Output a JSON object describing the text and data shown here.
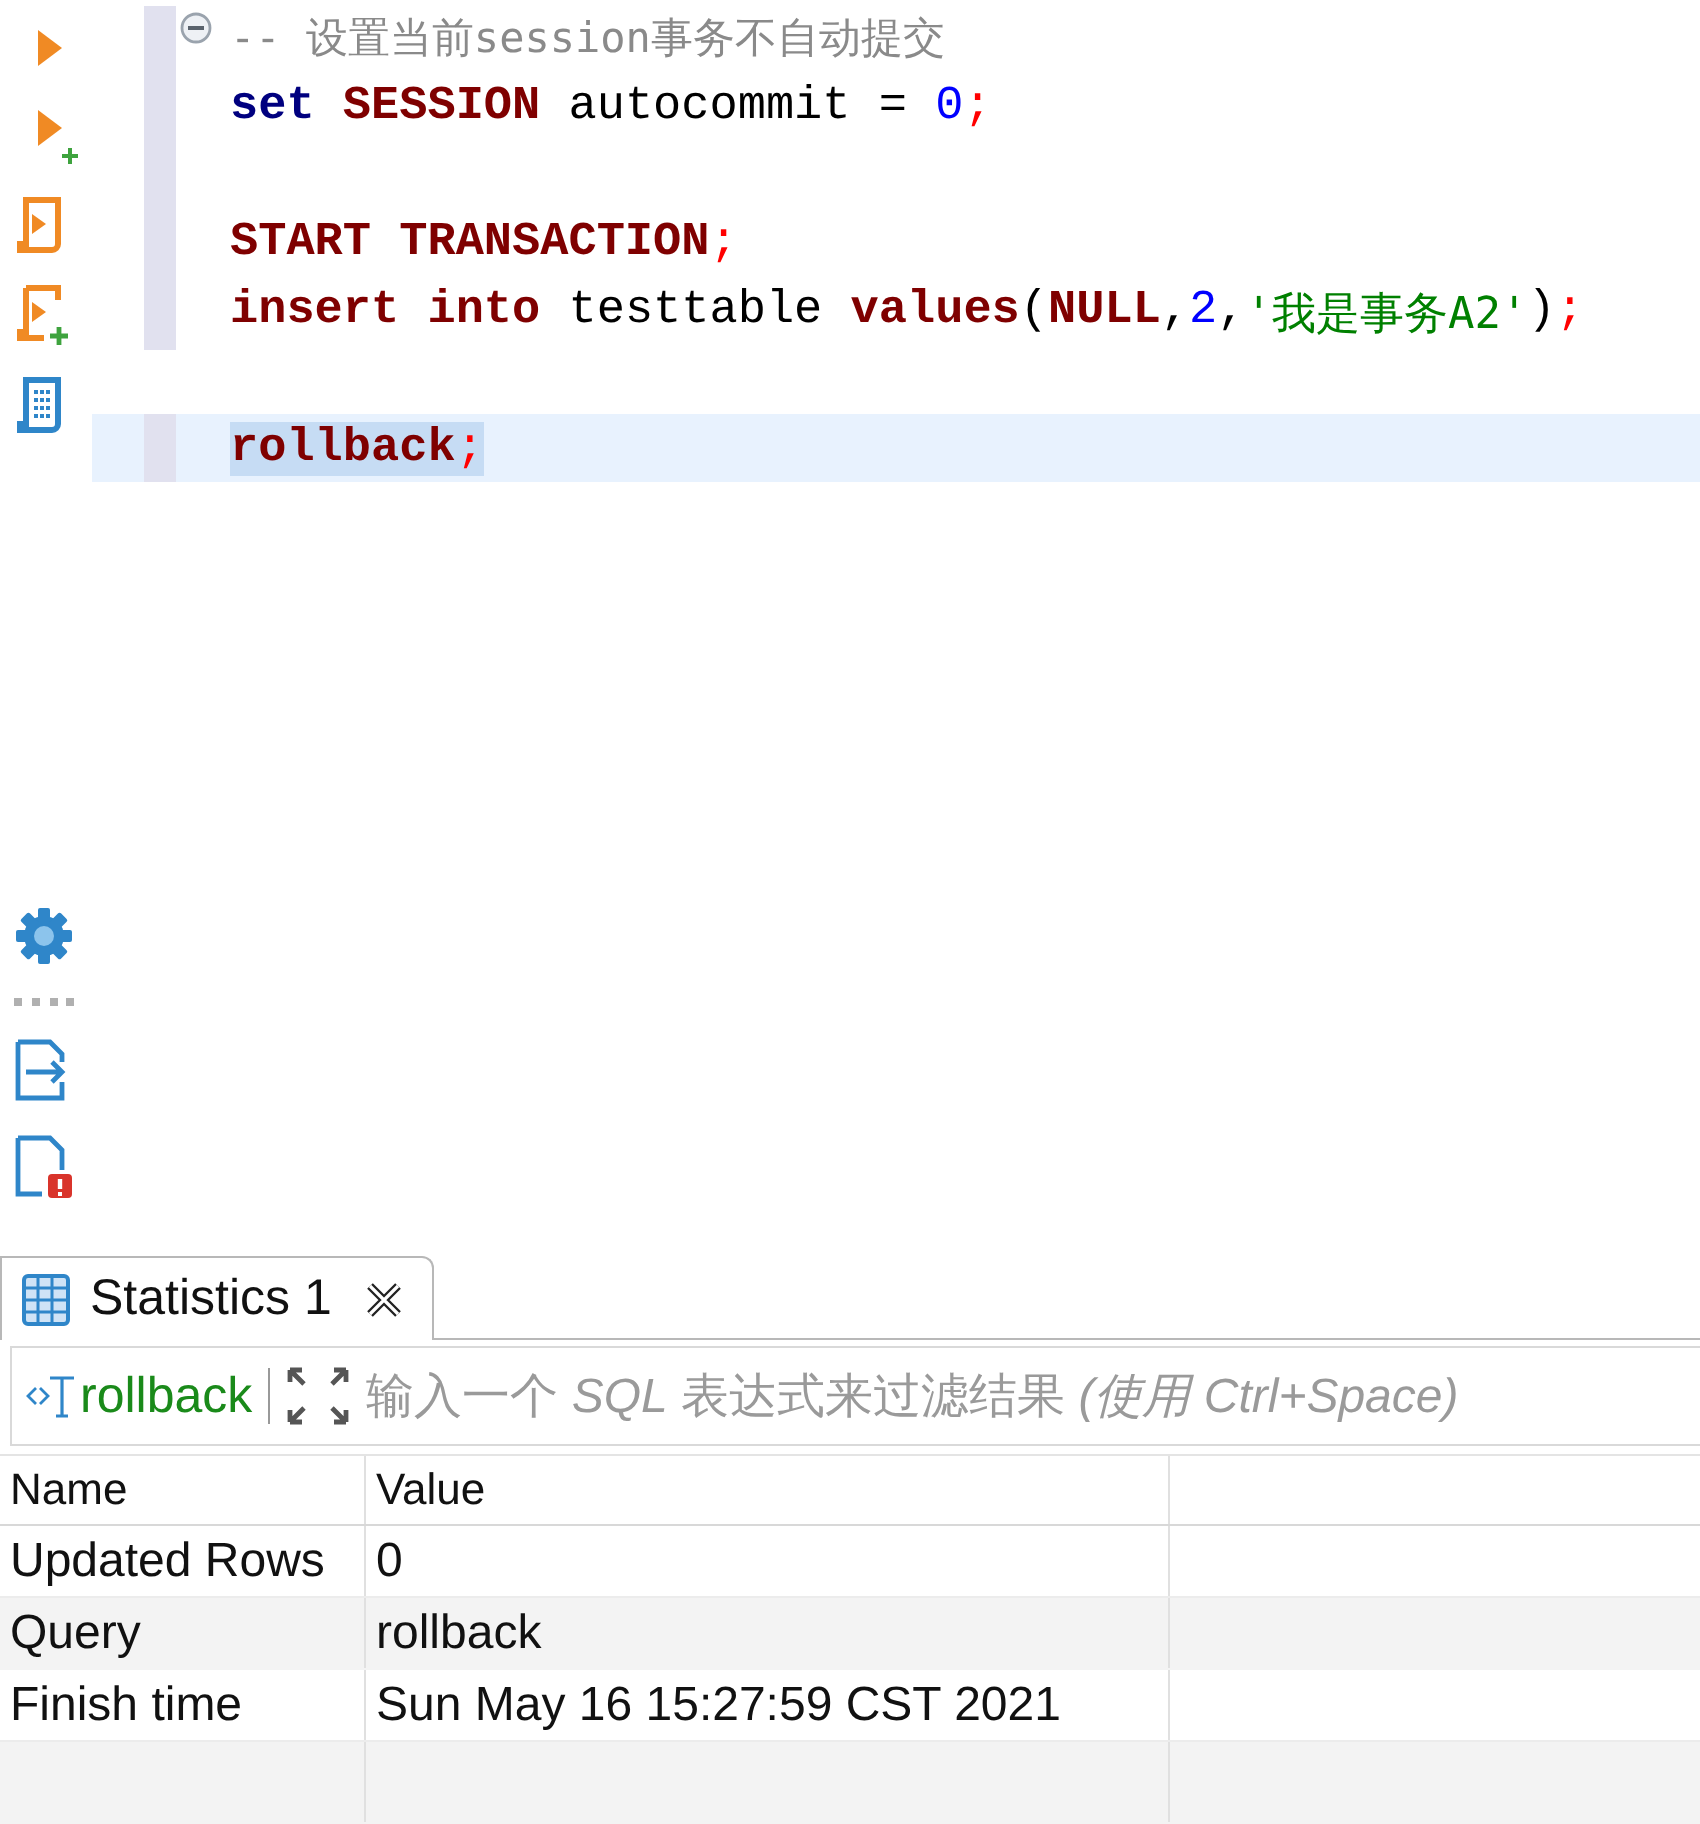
{
  "editor": {
    "lines": [
      {
        "marked": true,
        "fold": true,
        "current": false,
        "tokens": [
          {
            "kind": "comment",
            "text": "-- 设置当前session事务不自动提交"
          }
        ]
      },
      {
        "marked": true,
        "fold": false,
        "current": false,
        "tokens": [
          {
            "kind": "keyword2",
            "text": "set "
          },
          {
            "kind": "keyword",
            "text": "SESSION"
          },
          {
            "kind": "plain",
            "text": " autocommit = "
          },
          {
            "kind": "number",
            "text": "0"
          },
          {
            "kind": "punct",
            "text": ";"
          }
        ]
      },
      {
        "marked": true,
        "fold": false,
        "current": false
      },
      {
        "marked": true,
        "fold": false,
        "current": false,
        "tokens": [
          {
            "kind": "keyword",
            "text": "START TRANSACTION"
          },
          {
            "kind": "punct",
            "text": ";"
          }
        ]
      },
      {
        "marked": true,
        "fold": false,
        "current": false,
        "tokens": [
          {
            "kind": "keyword",
            "text": "insert into"
          },
          {
            "kind": "plain",
            "text": " testtable "
          },
          {
            "kind": "keyword",
            "text": "values"
          },
          {
            "kind": "plain",
            "text": "("
          },
          {
            "kind": "keyword",
            "text": "NULL"
          },
          {
            "kind": "plain",
            "text": ","
          },
          {
            "kind": "number",
            "text": "2"
          },
          {
            "kind": "plain",
            "text": ","
          },
          {
            "kind": "string",
            "text": "'我是事务A2'"
          },
          {
            "kind": "plain",
            "text": ")"
          },
          {
            "kind": "punct",
            "text": ";"
          }
        ]
      },
      {
        "marked": false,
        "fold": false,
        "current": false
      },
      {
        "marked": true,
        "fold": false,
        "current": true,
        "tokens": [
          {
            "kind": "keyword",
            "text": "rollback"
          },
          {
            "kind": "punct",
            "text": ";"
          }
        ]
      }
    ]
  },
  "results": {
    "tab": {
      "label": "Statistics 1",
      "selected": true
    },
    "filter": {
      "query": "rollback",
      "placeholder": "输入一个 *SQL* 表达式来过滤结果 *(使用 Ctrl+Space)*"
    },
    "table": {
      "columns": [
        "Name",
        "Value"
      ],
      "rows": [
        {
          "name": "Updated Rows",
          "value": "0"
        },
        {
          "name": "Query",
          "value": "rollback"
        },
        {
          "name": "Finish time",
          "value": "Sun May 16 15:27:59 CST 2021"
        }
      ]
    }
  }
}
